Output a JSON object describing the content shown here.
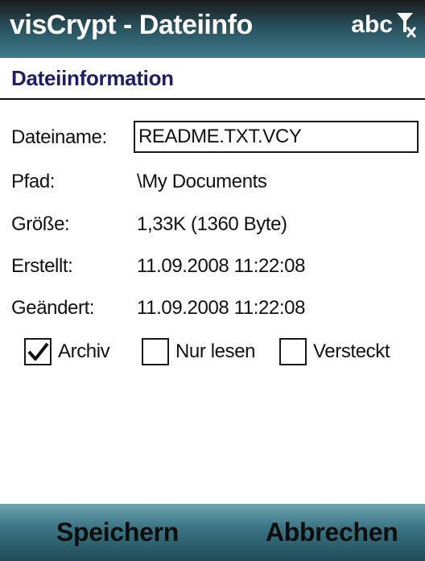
{
  "window": {
    "title": "visCrypt - Dateiinfo",
    "input_mode": "abc"
  },
  "section": {
    "title": "Dateiinformation"
  },
  "fields": {
    "filename": {
      "label": "Dateiname:",
      "value": "README.TXT.VCY"
    },
    "path": {
      "label": "Pfad:",
      "value": "\\My Documents"
    },
    "size": {
      "label": "Größe:",
      "value": "1,33K (1360 Byte)"
    },
    "created": {
      "label": "Erstellt:",
      "value": "11.09.2008 11:22:08"
    },
    "modified": {
      "label": "Geändert:",
      "value": "11.09.2008 11:22:08"
    }
  },
  "attributes": [
    {
      "label": "Archiv",
      "checked": true
    },
    {
      "label": "Nur lesen",
      "checked": false
    },
    {
      "label": "Versteckt",
      "checked": false
    }
  ],
  "softkeys": {
    "left": "Speichern",
    "right": "Abbrechen"
  },
  "colors": {
    "section_title": "#1c1e6b",
    "titlebar_text": "#ffffff"
  },
  "icons": {
    "input_indicator": "antenna-no-signal-icon",
    "checkmark": "checkmark-icon"
  }
}
